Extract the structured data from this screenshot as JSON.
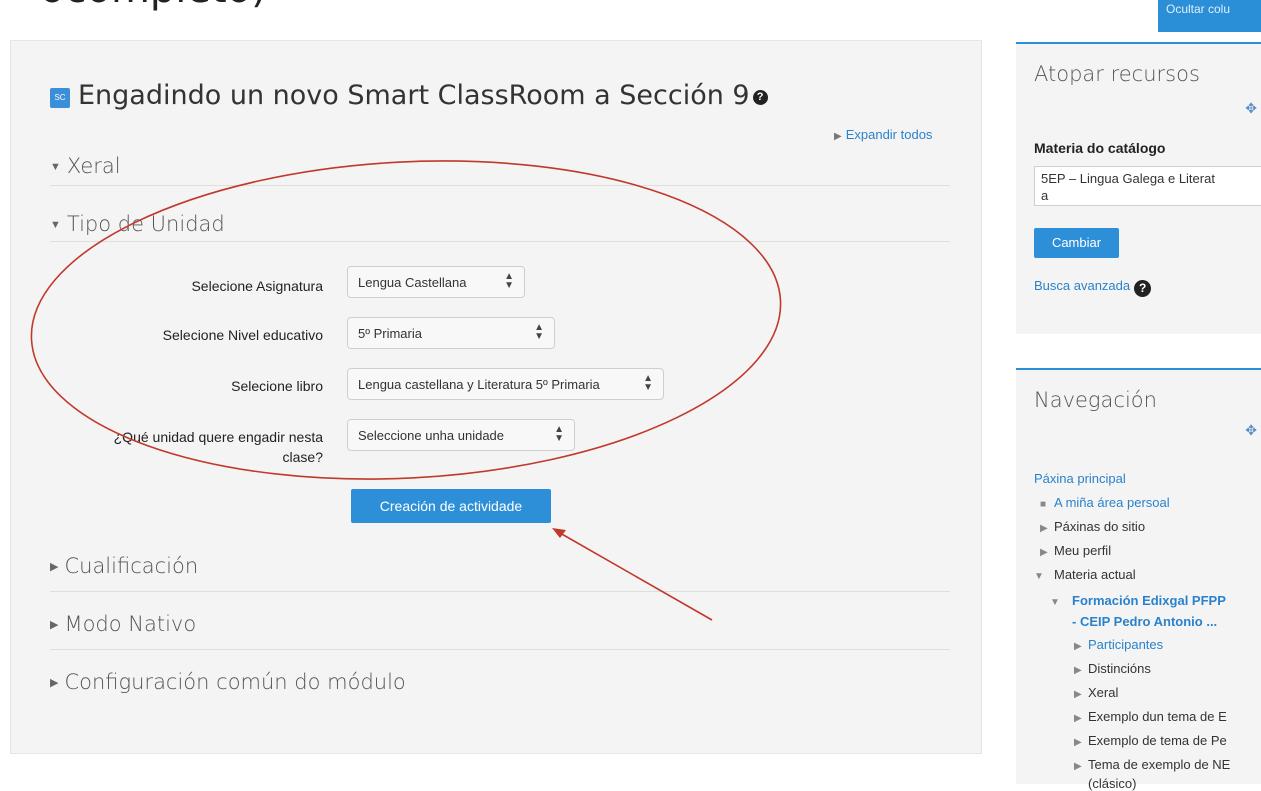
{
  "top_cut_text": "ocompleto)",
  "hide_blocks_button": "Ocultar colu",
  "page_title": "Engadindo un novo Smart ClassRoom a Sección 9",
  "title_icon_text": "SC",
  "help_glyph": "?",
  "expand_all": "Expandir todos",
  "sections": {
    "general": "Xeral",
    "unit_type": "Tipo de Unidad",
    "grading": "Cualificación",
    "native_mode": "Modo Nativo",
    "common_settings": "Configuración común do módulo"
  },
  "form": {
    "subject_label": "Selecione Asignatura",
    "subject_value": "Lengua Castellana",
    "level_label": "Selecione Nivel educativo",
    "level_value": "5º Primaria",
    "book_label": "Selecione libro",
    "book_value": "Lengua castellana y Literatura 5º Primaria",
    "unit_label_line1": "¿Qué unidad quere engadir nesta",
    "unit_label_line2": "clase?",
    "unit_value": "Seleccione unha unidade"
  },
  "create_button": "Creación de actividade",
  "find_resources": {
    "title": "Atopar recursos",
    "catalog_label": "Materia do catálogo",
    "catalog_value_line1": "5EP – Lingua Galega e Literat",
    "catalog_value_line2": "a",
    "change_button": "Cambiar",
    "advanced_search": "Busca avanzada"
  },
  "navigation": {
    "title": "Navegación",
    "home": "Páxina principal",
    "my_area": "A miña área persoal",
    "site_pages": "Páxinas do sitio",
    "profile": "Meu perfil",
    "current_course": "Materia actual",
    "course_name_line1": "Formación Edixgal PFPP",
    "course_name_line2": "- CEIP Pedro Antonio ...",
    "participants": "Participantes",
    "badges": "Distincións",
    "general": "Xeral",
    "example1": "Exemplo dun tema de E",
    "example2": "Exemplo de tema de Pe",
    "example3": "Tema de exemplo de NE",
    "example3_cont": "(clásico)"
  },
  "colors": {
    "accent": "#2e8fd9",
    "link": "#2a82cc",
    "annotation": "#c0392b"
  }
}
